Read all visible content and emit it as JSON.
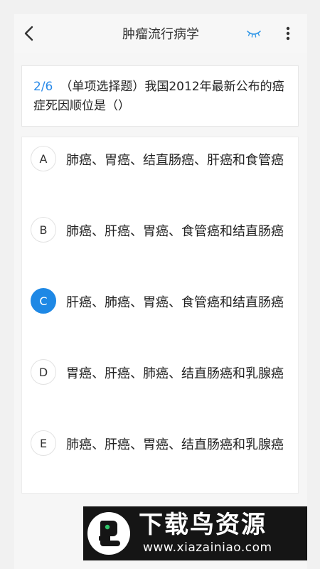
{
  "header": {
    "title": "肿瘤流行病学"
  },
  "question": {
    "number": "2/6",
    "text": "（单项选择题）我国2012年最新公布的癌症死因顺位是（）"
  },
  "options": [
    {
      "letter": "A",
      "text": "肺癌、胃癌、结直肠癌、肝癌和食管癌",
      "selected": false
    },
    {
      "letter": "B",
      "text": "肺癌、肝癌、胃癌、食管癌和结直肠癌",
      "selected": false
    },
    {
      "letter": "C",
      "text": "肝癌、肺癌、胃癌、食管癌和结直肠癌",
      "selected": true
    },
    {
      "letter": "D",
      "text": "胃癌、肝癌、肺癌、结直肠癌和乳腺癌",
      "selected": false
    },
    {
      "letter": "E",
      "text": "肺癌、肝癌、胃癌、结直肠癌和乳腺癌",
      "selected": false
    }
  ],
  "watermark": {
    "name": "下载鸟资源",
    "url": "www.xiazainiao.com"
  },
  "colors": {
    "accent": "#1e88e5",
    "question_number": "#2a8ae8",
    "eye_icon": "#3a9be8"
  },
  "icons": {
    "back": "chevron-left-icon",
    "visibility": "closed-eye-icon",
    "menu": "more-vertical-icon"
  }
}
